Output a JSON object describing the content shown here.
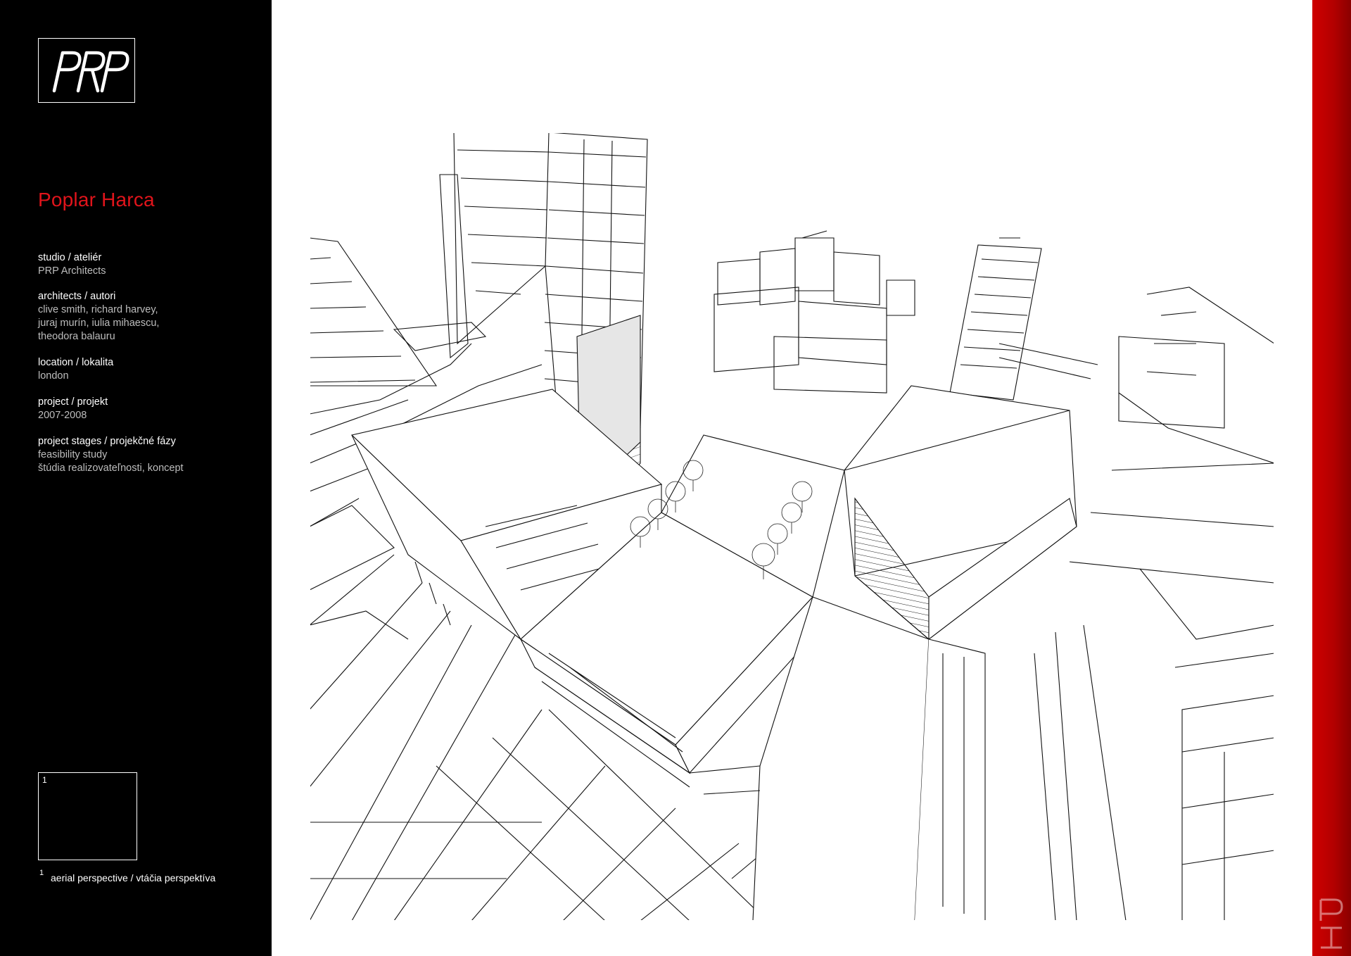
{
  "logo": {
    "text": "PRP"
  },
  "project": {
    "title": "Poplar Harca"
  },
  "info": [
    {
      "label": "studio / ateliér",
      "values": [
        "PRP Architects"
      ]
    },
    {
      "label": "architects / autori",
      "values": [
        "clive smith, richard harvey,",
        "juraj murín, iulia mihaescu,",
        "theodora balauru"
      ]
    },
    {
      "label": "location / lokalita",
      "values": [
        "london"
      ]
    },
    {
      "label": "project / projekt",
      "values": [
        "2007-2008"
      ]
    },
    {
      "label": "project stages / projekčné fázy",
      "values": [
        "feasibility study",
        "štúdia realizovateľnosti, koncept"
      ]
    }
  ],
  "thumbnail": {
    "number": "1"
  },
  "caption": {
    "number": "1",
    "text": "aerial perspective / vtáčia perspektíva"
  },
  "sidebar_mark": {
    "text": "PH"
  },
  "colors": {
    "accent_red": "#e0141b",
    "sidebar_bg": "#000000",
    "bar_red": "#c00000"
  }
}
